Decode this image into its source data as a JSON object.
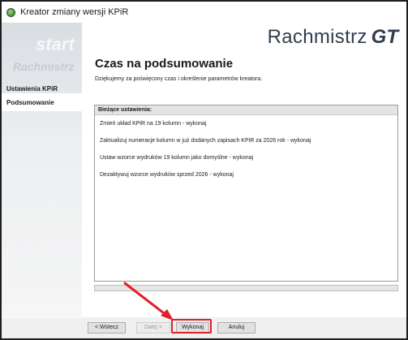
{
  "window": {
    "title": "Kreator zmiany wersji KPiR"
  },
  "brand": {
    "name": "Rachmistrz",
    "suffix": "GT"
  },
  "sidebar": {
    "watermark": [
      "start",
      "Rachmistrz"
    ],
    "items": [
      {
        "label": "Ustawienia KPiR"
      },
      {
        "label": "Podsumowanie"
      }
    ]
  },
  "page": {
    "title": "Czas na podsumowanie",
    "description": "Dziękujemy za poświęcony czas i określenie parametrów kreatora."
  },
  "settings": {
    "header": "Bieżące ustawienia:",
    "lines": [
      "Zmień układ KPiR na 19 kolumn - wykonaj",
      "Zaktualizuj numeracje kolumn w już dodanych zapisach KPiR za 2026 rok - wykonaj",
      "Ustaw wzorce wydruków 19 kolumn jako domyślne - wykonaj",
      "Dezaktywuj wzorce wydruków sprzed 2026 - wykonaj"
    ]
  },
  "buttons": {
    "back": "< Wstecz",
    "next": "Dalej >",
    "run": "Wykonaj",
    "cancel": "Anuluj"
  },
  "colors": {
    "highlight": "#e0202a",
    "brand": "#2f3e4e"
  }
}
